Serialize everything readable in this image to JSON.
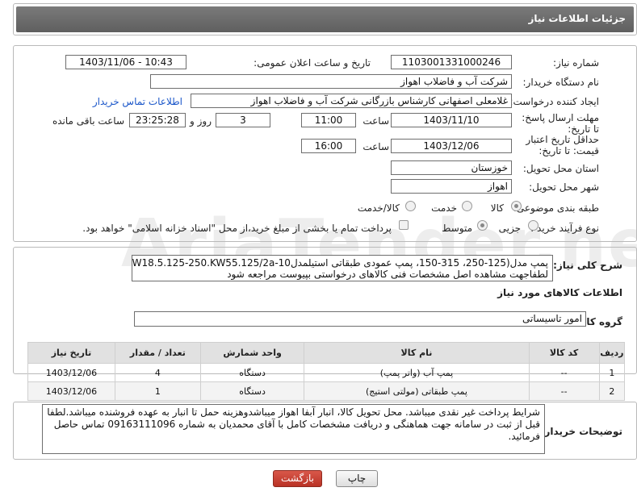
{
  "header": {
    "title": "جزئیات اطلاعات نیاز"
  },
  "form": {
    "need_number_label": "شماره نیاز:",
    "need_number": "1103001331000246",
    "announce_label": "تاریخ و ساعت اعلان عمومی:",
    "announce_value": "1403/11/06 - 10:43",
    "buyer_label": "نام دستگاه خریدار:",
    "buyer_value": "شرکت آب و فاضلاب اهواز",
    "creator_label": "ایجاد کننده درخواست:",
    "creator_value": "غلامعلی اصفهانی کارشناس بازرگانی شرکت آب و فاضلاب اهواز",
    "contact_link": "اطلاعات تماس خریدار",
    "deadline_label": "مهلت ارسال پاسخ: تا تاریخ:",
    "deadline_date": "1403/11/10",
    "time_label": "ساعت",
    "deadline_time": "11:00",
    "days_value": "3",
    "days_label": "روز و",
    "remaining_value": "23:25:28",
    "remaining_label": "ساعت باقی مانده",
    "validity_label": "حداقل تاریخ اعتبار قیمت: تا تاریخ:",
    "validity_date": "1403/12/06",
    "validity_time_label": "ساعت",
    "validity_time": "16:00",
    "province_label": "استان محل تحویل:",
    "province_value": "خوزستان",
    "city_label": "شهر محل تحویل:",
    "city_value": "اهواز",
    "category_label": "طبقه بندی موضوعی:",
    "category_options": [
      "کالا",
      "خدمت",
      "کالا/خدمت"
    ],
    "process_label": "نوع فرآیند خرید :",
    "process_options": [
      "جزیی",
      "متوسط"
    ],
    "payment_note": "پرداخت تمام یا بخشی از مبلغ خرید،از محل \"اسناد خزانه اسلامی\" خواهد بود."
  },
  "summary": {
    "label": "شرح کلی نیاز:",
    "line1": "پمپ مدل(125-250، 315-150، پمپ عمودی طبقاتی استیلمدل10-KW18.5.125-250.KW55.125/2a)",
    "line2": "لطفاجهت مشاهده اصل مشخصات فنی کالاهای درخواستی بپیوست مراجعه شود"
  },
  "goods": {
    "section_title": "اطلاعات کالاهای مورد نیاز",
    "group_label": "گروه کالا:",
    "group_value": "امور تاسیساتی",
    "columns": [
      "ردیف",
      "کد کالا",
      "نام کالا",
      "واحد شمارش",
      "تعداد / مقدار",
      "تاریخ نیاز"
    ],
    "rows": [
      {
        "row": "1",
        "code": "--",
        "name": "پمپ آب (واتر پمپ)",
        "unit": "دستگاه",
        "qty": "4",
        "date": "1403/12/06"
      },
      {
        "row": "2",
        "code": "--",
        "name": "پمپ طبقاتی (مولتی استیج)",
        "unit": "دستگاه",
        "qty": "1",
        "date": "1403/12/06"
      }
    ]
  },
  "buyer_notes": {
    "label": "توضیحات خریدار:",
    "line1": "شرایط پرداخت غیر نقدی میباشد. محل تحویل کالا، انبار آبفا اهواز میباشدوهزینه حمل تا انبار به عهده فروشنده میباشد.لطفا",
    "line2": "قبل از ثبت در سامانه جهت هماهنگی و دریافت مشخصات کامل با آقای  محمدیان به شماره 09163111096 تماس حاصل",
    "line3": "فرمائید."
  },
  "buttons": {
    "back": "بازگشت",
    "print": "چاپ"
  },
  "colors": {
    "header_bg": "#6c6c6c",
    "link": "#1a56c9",
    "back_button_bg": "#c0392b"
  }
}
